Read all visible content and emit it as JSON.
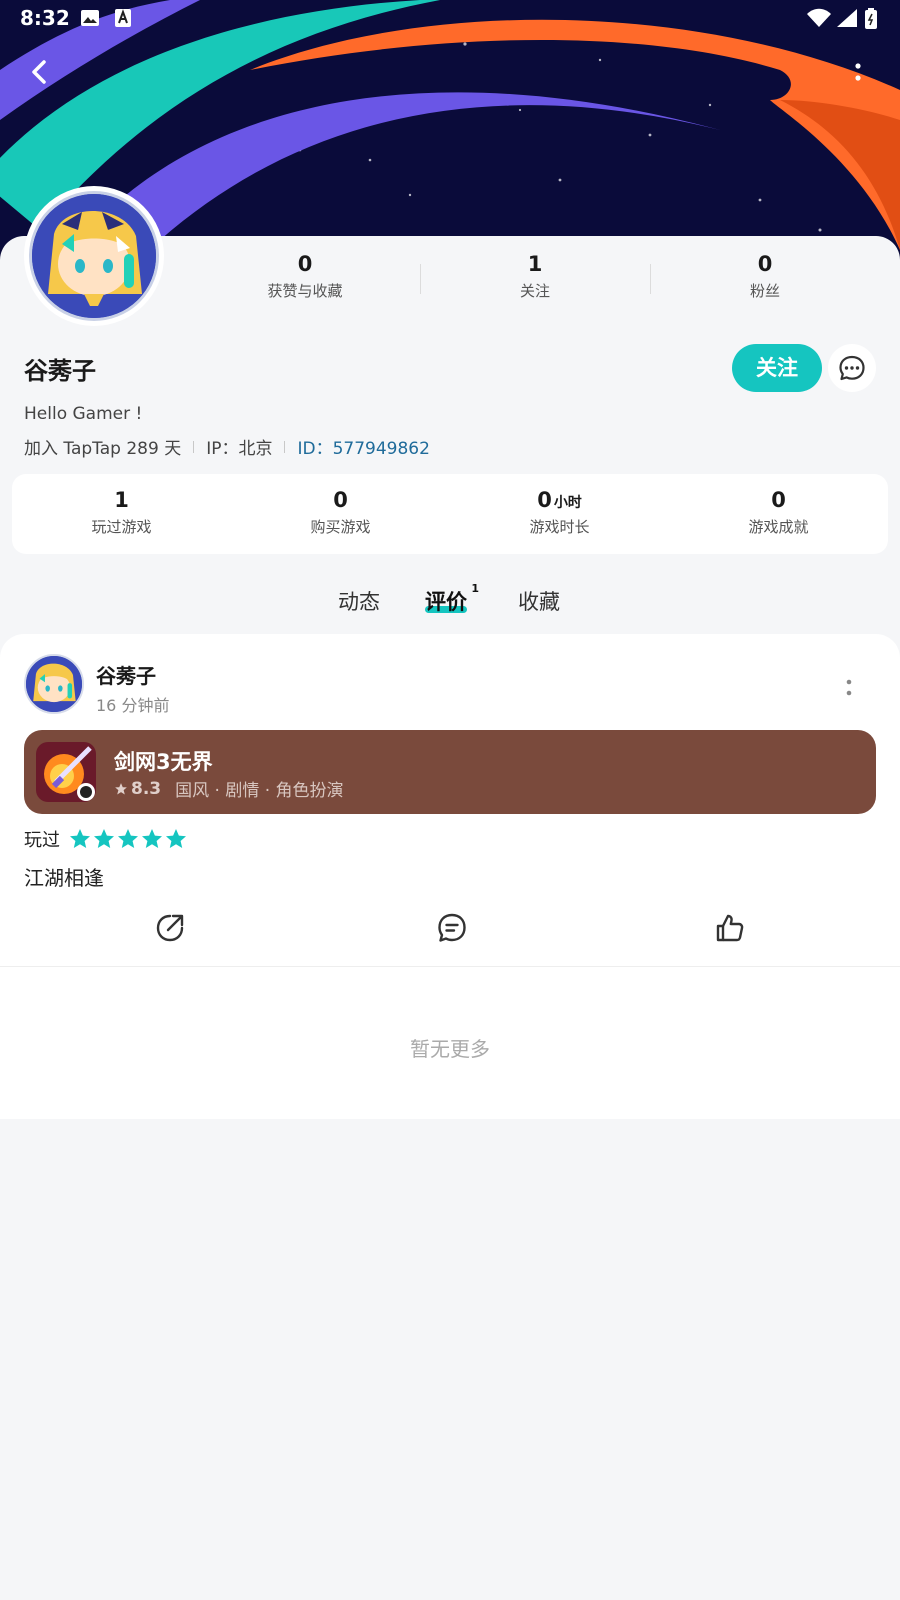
{
  "status_bar": {
    "time": "8:32"
  },
  "profile": {
    "name": "谷莠子",
    "bio": "Hello Gamer !",
    "joined": "加入 TapTap 289 天",
    "ip": "IP：北京",
    "uid": "ID：577949862",
    "follow_label": "关注",
    "stats": [
      {
        "value": "0",
        "label": "获赞与收藏"
      },
      {
        "value": "1",
        "label": "关注"
      },
      {
        "value": "0",
        "label": "粉丝"
      }
    ]
  },
  "game_stats": [
    {
      "value": "1",
      "unit": "",
      "label": "玩过游戏"
    },
    {
      "value": "0",
      "unit": "",
      "label": "购买游戏"
    },
    {
      "value": "0",
      "unit": "小时",
      "label": "游戏时长"
    },
    {
      "value": "0",
      "unit": "",
      "label": "游戏成就"
    }
  ],
  "tabs": [
    {
      "label": "动态",
      "active": false
    },
    {
      "label": "评价",
      "badge": "1",
      "active": true
    },
    {
      "label": "收藏",
      "active": false
    }
  ],
  "review": {
    "author": "谷莠子",
    "time": "16 分钟前",
    "game": {
      "name": "剑网3无界",
      "score": "8.3",
      "tags": "国风 · 剧情 · 角色扮演",
      "card_color": "#7a4a3c"
    },
    "played_label": "玩过",
    "rating": 5,
    "text": "江湖相逢"
  },
  "footer": {
    "no_more": "暂无更多"
  },
  "colors": {
    "accent": "#15c5c0",
    "uid_link": "#1f6b9a"
  }
}
